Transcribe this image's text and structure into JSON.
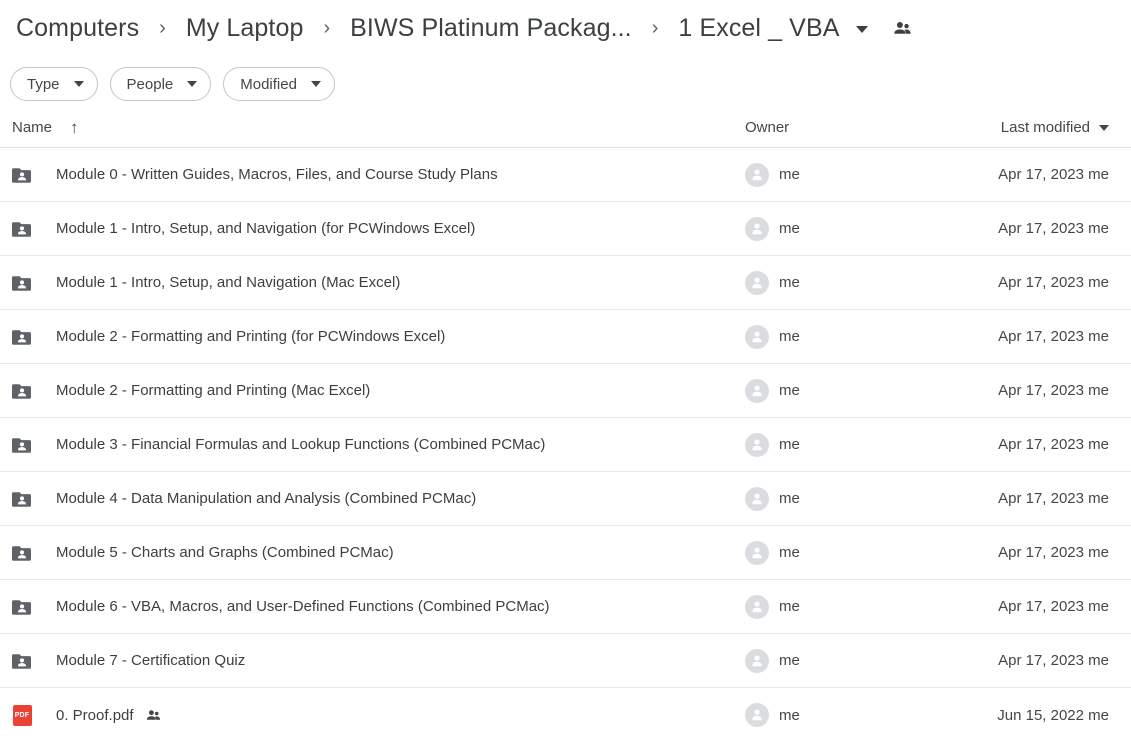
{
  "breadcrumb": {
    "items": [
      {
        "label": "Computers"
      },
      {
        "label": "My Laptop"
      },
      {
        "label": "BIWS Platinum Packag..."
      },
      {
        "label": "1 Excel _ VBA"
      }
    ],
    "separator": "›",
    "caret_icon": "chevron-down-icon",
    "people_icon": "people-icon"
  },
  "filters": {
    "chips": [
      {
        "label": "Type"
      },
      {
        "label": "People"
      },
      {
        "label": "Modified"
      }
    ],
    "caret_icon": "chevron-down-icon"
  },
  "table": {
    "headers": {
      "name": "Name",
      "name_sort_icon": "sort-ascending-arrow",
      "name_sort_glyph": "↑",
      "owner": "Owner",
      "modified": "Last modified",
      "modified_caret_icon": "chevron-down-icon"
    },
    "rows": [
      {
        "icon": "shared-folder-icon",
        "type": "folder",
        "name": "Module 0 - Written Guides, Macros, Files, and Course Study Plans",
        "shared": false,
        "owner": "me",
        "owner_avatar": "person-avatar-icon",
        "modified": "Apr 17, 2023 me"
      },
      {
        "icon": "shared-folder-icon",
        "type": "folder",
        "name": "Module 1 - Intro, Setup, and Navigation (for PCWindows Excel)",
        "shared": false,
        "owner": "me",
        "owner_avatar": "person-avatar-icon",
        "modified": "Apr 17, 2023 me"
      },
      {
        "icon": "shared-folder-icon",
        "type": "folder",
        "name": "Module 1 - Intro, Setup, and Navigation (Mac Excel)",
        "shared": false,
        "owner": "me",
        "owner_avatar": "person-avatar-icon",
        "modified": "Apr 17, 2023 me"
      },
      {
        "icon": "shared-folder-icon",
        "type": "folder",
        "name": "Module 2 - Formatting and Printing (for PCWindows Excel)",
        "shared": false,
        "owner": "me",
        "owner_avatar": "person-avatar-icon",
        "modified": "Apr 17, 2023 me"
      },
      {
        "icon": "shared-folder-icon",
        "type": "folder",
        "name": "Module 2 - Formatting and Printing (Mac Excel)",
        "shared": false,
        "owner": "me",
        "owner_avatar": "person-avatar-icon",
        "modified": "Apr 17, 2023 me"
      },
      {
        "icon": "shared-folder-icon",
        "type": "folder",
        "name": "Module 3 - Financial Formulas and Lookup Functions (Combined PCMac)",
        "shared": false,
        "owner": "me",
        "owner_avatar": "person-avatar-icon",
        "modified": "Apr 17, 2023 me"
      },
      {
        "icon": "shared-folder-icon",
        "type": "folder",
        "name": "Module 4 - Data Manipulation and Analysis (Combined PCMac)",
        "shared": false,
        "owner": "me",
        "owner_avatar": "person-avatar-icon",
        "modified": "Apr 17, 2023 me"
      },
      {
        "icon": "shared-folder-icon",
        "type": "folder",
        "name": "Module 5 - Charts and Graphs (Combined PCMac)",
        "shared": false,
        "owner": "me",
        "owner_avatar": "person-avatar-icon",
        "modified": "Apr 17, 2023 me"
      },
      {
        "icon": "shared-folder-icon",
        "type": "folder",
        "name": "Module 6 - VBA, Macros, and User-Defined Functions (Combined PCMac)",
        "shared": false,
        "owner": "me",
        "owner_avatar": "person-avatar-icon",
        "modified": "Apr 17, 2023 me"
      },
      {
        "icon": "shared-folder-icon",
        "type": "folder",
        "name": "Module 7 - Certification Quiz",
        "shared": false,
        "owner": "me",
        "owner_avatar": "person-avatar-icon",
        "modified": "Apr 17, 2023 me"
      },
      {
        "icon": "pdf-file-icon",
        "icon_label": "PDF",
        "type": "pdf",
        "name": "0. Proof.pdf",
        "shared": true,
        "share_icon": "people-shared-icon",
        "owner": "me",
        "owner_avatar": "person-avatar-icon",
        "modified": "Jun 15, 2022 me"
      }
    ]
  },
  "colors": {
    "text_primary": "#3c4043",
    "text_secondary": "#444746",
    "folder_icon": "#5f6368",
    "pdf_red": "#ea4335",
    "avatar_gray": "#dadce0",
    "divider": "#e8eaed",
    "chip_border": "#c4c7c5"
  }
}
